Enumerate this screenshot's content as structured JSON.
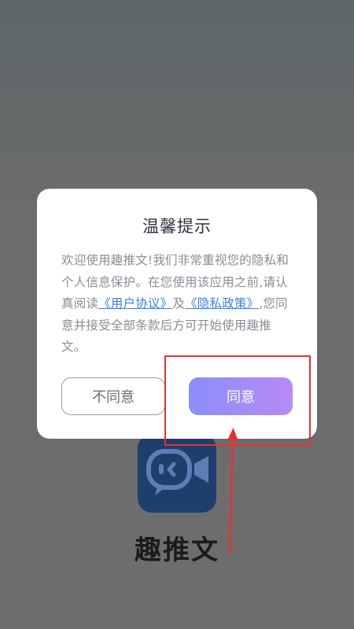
{
  "app": {
    "name": "趣推文"
  },
  "dialog": {
    "title": "温馨提示",
    "body": {
      "intro": "欢迎使用趣推文!我们非常重视您的隐私和个人信息保护。在您使用该应用之前,请认真阅读",
      "user_agreement_link": "《用户协议》",
      "connector": "及",
      "privacy_link": "《隐私政策》",
      "outro": ",您同意并接受全部条款后方可开始使用趣推文。"
    },
    "decline_label": "不同意",
    "agree_label": "同意"
  },
  "colors": {
    "overlay": "#6c6c6c",
    "link": "#3d82e6",
    "agree_gradient_start": "#8a8efb",
    "agree_gradient_end": "#b88af5",
    "annotation_red": "#e8312f",
    "logo_bg": "#1f3e6c"
  },
  "icons": {
    "logo": "video-camera-chat-icon",
    "annotation": "arrow-up-icon"
  }
}
